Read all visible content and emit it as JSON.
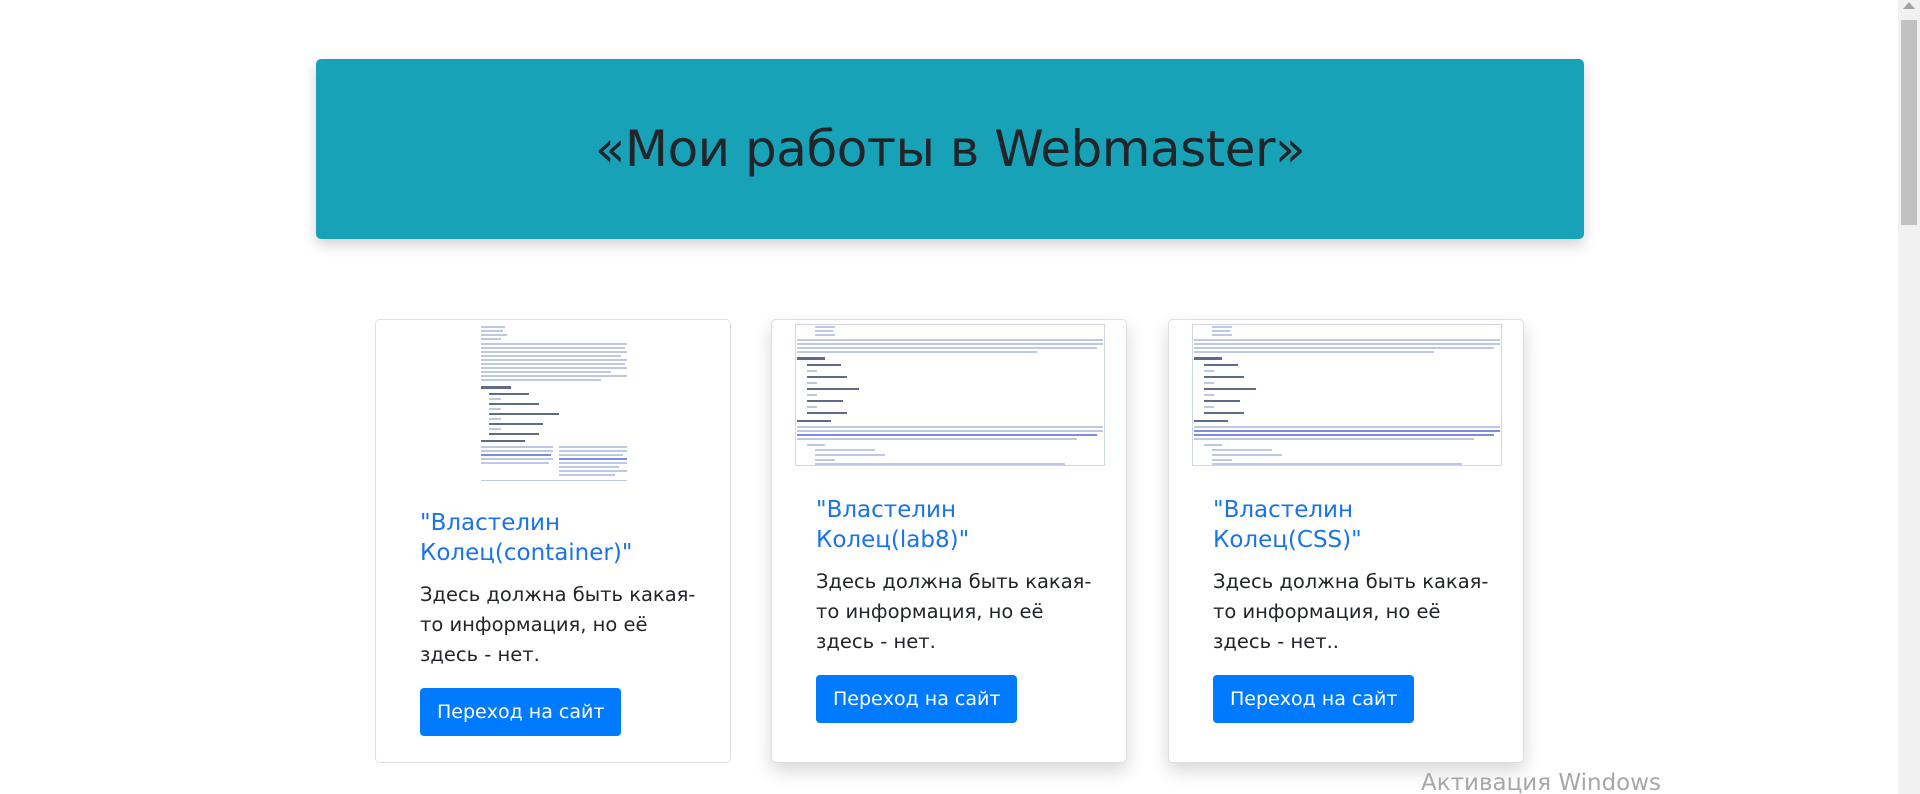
{
  "hero": {
    "title": "«Мои работы в Webmaster»"
  },
  "cards": [
    {
      "title": "\"Властелин Колец(container)\"",
      "text": "Здесь должна быть какая-то информация, но её здесь - нет.",
      "button": "Переход на сайт"
    },
    {
      "title": "\"Властелин Колец(lab8)\"",
      "text": "Здесь должна быть какая-то информация, но её здесь - нет.",
      "button": "Переход на сайт"
    },
    {
      "title": "\"Властелин Колец(CSS)\"",
      "text": "Здесь должна быть какая-то информация, но её здесь - нет..",
      "button": "Переход на сайт"
    }
  ],
  "watermark": "Активация Windows",
  "colors": {
    "hero_bg": "#17a2b8",
    "link": "#1a73e8",
    "button": "#007bff"
  }
}
